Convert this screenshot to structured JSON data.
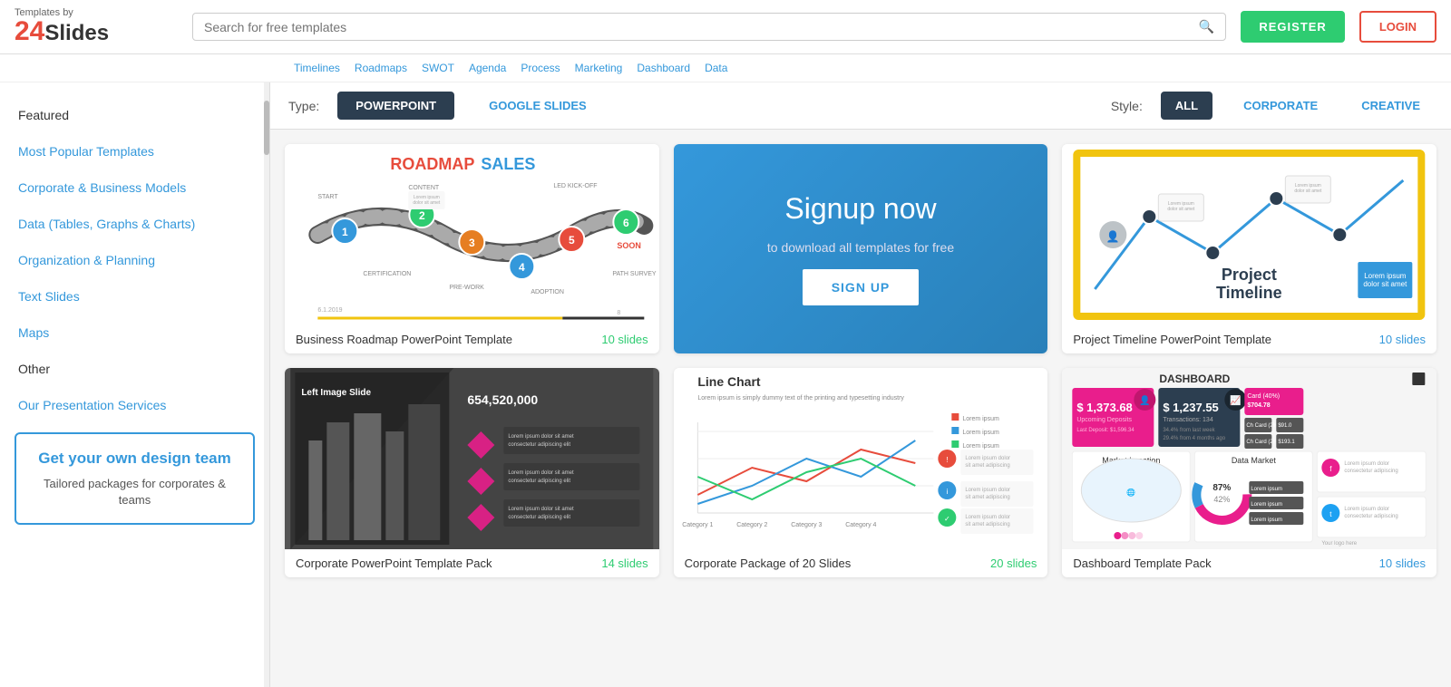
{
  "header": {
    "logo_by": "Templates by",
    "logo_num": "24",
    "logo_name": "Slides",
    "search_placeholder": "Search for free templates",
    "register_label": "REGISTER",
    "login_label": "LOGIN"
  },
  "tagbar": {
    "tags": [
      "Timelines",
      "Roadmaps",
      "SWOT",
      "Agenda",
      "Process",
      "Marketing",
      "Dashboard",
      "Data"
    ]
  },
  "filter": {
    "type_label": "Type:",
    "type_options": [
      "POWERPOINT",
      "GOOGLE SLIDES"
    ],
    "type_active": "POWERPOINT",
    "style_label": "Style:",
    "style_options": [
      "ALL",
      "CORPORATE",
      "CREATIVE"
    ],
    "style_active": "ALL"
  },
  "sidebar": {
    "items": [
      {
        "label": "Featured",
        "href": "#",
        "is_link": false
      },
      {
        "label": "Most Popular Templates",
        "href": "#",
        "is_link": true
      },
      {
        "label": "Corporate & Business Models",
        "href": "#",
        "is_link": true
      },
      {
        "label": "Data (Tables, Graphs & Charts)",
        "href": "#",
        "is_link": true
      },
      {
        "label": "Organization & Planning",
        "href": "#",
        "is_link": true
      },
      {
        "label": "Text Slides",
        "href": "#",
        "is_link": true
      },
      {
        "label": "Maps",
        "href": "#",
        "is_link": true
      },
      {
        "label": "Other",
        "href": "#",
        "is_link": false
      }
    ],
    "services_label": "Our Presentation Services",
    "promo_title": "Get your own design team",
    "promo_sub": "Tailored packages for corporates & teams"
  },
  "cards": [
    {
      "type": "roadmap",
      "title": "Business Roadmap PowerPoint Template",
      "slides": "10 slides",
      "slides_color": "#2ecc71"
    },
    {
      "type": "signup",
      "heading": "Signup now",
      "sub": "to download all templates for free",
      "btn": "SIGN UP"
    },
    {
      "type": "timeline",
      "title": "Project Timeline PowerPoint Template",
      "slides": "10 slides",
      "slides_color": "#3498db"
    },
    {
      "type": "corporate",
      "title": "Corporate PowerPoint Template Pack",
      "slides": "14 slides",
      "slides_color": "#2ecc71"
    },
    {
      "type": "linechart",
      "title": "Corporate Package of 20 Slides",
      "slides": "20 slides",
      "slides_color": "#2ecc71"
    },
    {
      "type": "dashboard",
      "title": "Dashboard Template Pack",
      "slides": "10 slides",
      "slides_color": "#3498db"
    }
  ]
}
